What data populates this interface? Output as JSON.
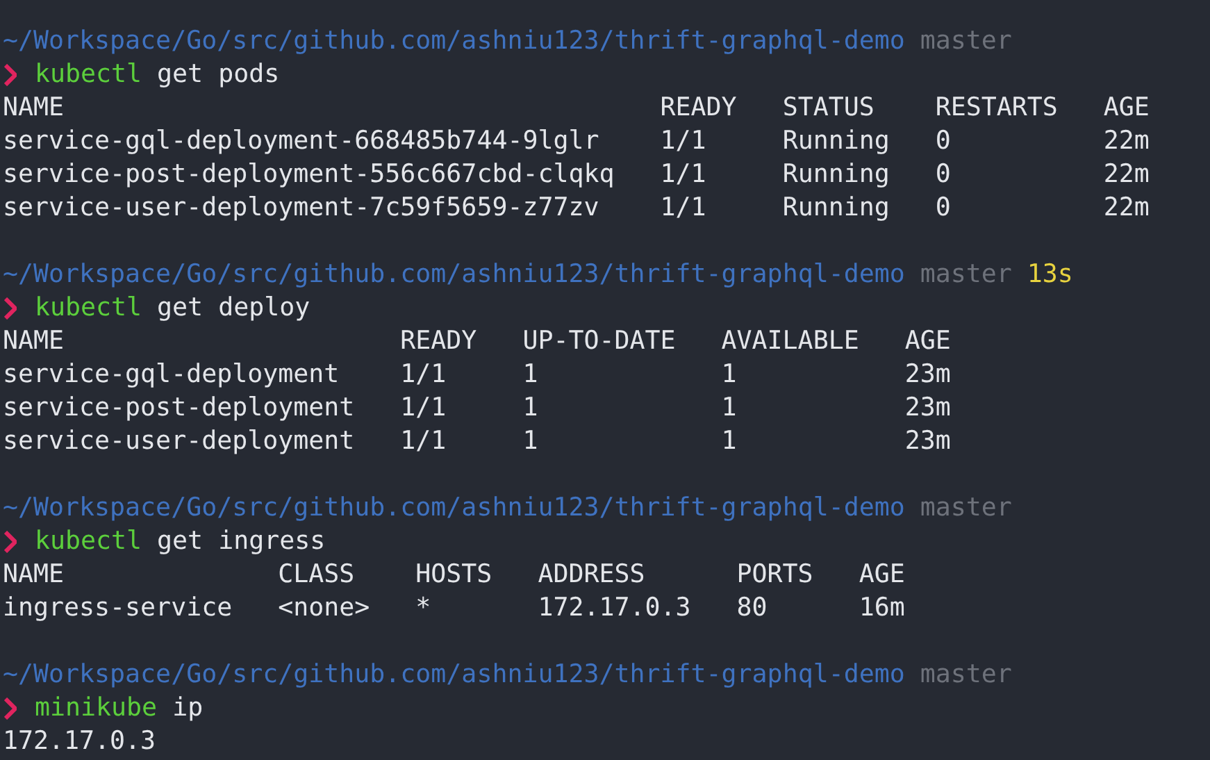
{
  "blocks": [
    {
      "prompt": {
        "path": "~/Workspace/Go/src/github.com/ashniu123/thrift-graphql-demo",
        "branch": "master"
      },
      "command": {
        "program": "kubectl",
        "args": "get pods"
      },
      "output": {
        "kind": "table",
        "columns": [
          "NAME",
          "READY",
          "STATUS",
          "RESTARTS",
          "AGE"
        ],
        "rows": [
          [
            "service-gql-deployment-668485b744-9lglr",
            "1/1",
            "Running",
            "0",
            "22m"
          ],
          [
            "service-post-deployment-556c667cbd-clqkq",
            "1/1",
            "Running",
            "0",
            "22m"
          ],
          [
            "service-user-deployment-7c59f5659-z77zv",
            "1/1",
            "Running",
            "0",
            "22m"
          ]
        ]
      }
    },
    {
      "prompt": {
        "path": "~/Workspace/Go/src/github.com/ashniu123/thrift-graphql-demo",
        "branch": "master",
        "duration": "13s"
      },
      "command": {
        "program": "kubectl",
        "args": "get deploy"
      },
      "output": {
        "kind": "table",
        "columns": [
          "NAME",
          "READY",
          "UP-TO-DATE",
          "AVAILABLE",
          "AGE"
        ],
        "rows": [
          [
            "service-gql-deployment",
            "1/1",
            "1",
            "1",
            "23m"
          ],
          [
            "service-post-deployment",
            "1/1",
            "1",
            "1",
            "23m"
          ],
          [
            "service-user-deployment",
            "1/1",
            "1",
            "1",
            "23m"
          ]
        ]
      }
    },
    {
      "prompt": {
        "path": "~/Workspace/Go/src/github.com/ashniu123/thrift-graphql-demo",
        "branch": "master"
      },
      "command": {
        "program": "kubectl",
        "args": "get ingress"
      },
      "output": {
        "kind": "table",
        "columns": [
          "NAME",
          "CLASS",
          "HOSTS",
          "ADDRESS",
          "PORTS",
          "AGE"
        ],
        "rows": [
          [
            "ingress-service",
            "<none>",
            "*",
            "172.17.0.3",
            "80",
            "16m"
          ]
        ]
      }
    },
    {
      "prompt": {
        "path": "~/Workspace/Go/src/github.com/ashniu123/thrift-graphql-demo",
        "branch": "master"
      },
      "command": {
        "program": "minikube",
        "args": "ip"
      },
      "output": {
        "kind": "text",
        "lines": [
          "172.17.0.3"
        ]
      }
    }
  ]
}
